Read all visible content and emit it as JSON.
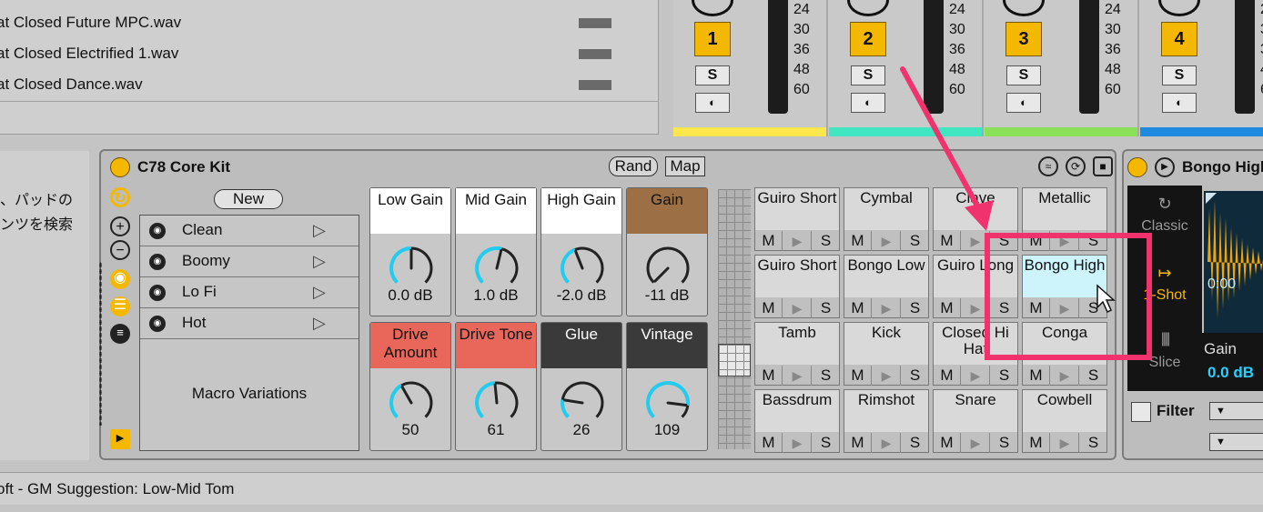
{
  "browser": {
    "files": [
      "at Closed Future MPC.wav",
      "at Closed Electrified 1.wav",
      "at Closed Dance.wav"
    ]
  },
  "mixer": {
    "scale": [
      "24",
      "30",
      "36",
      "48",
      "60"
    ],
    "solo_label": "S",
    "tracks": [
      {
        "number": "1",
        "color": "#fde74c"
      },
      {
        "number": "2",
        "color": "#3fe6c0"
      },
      {
        "number": "3",
        "color": "#8be05a"
      },
      {
        "number": "4",
        "color": "#1f8be0"
      }
    ]
  },
  "sidepanel": {
    "lines": [
      "、パッドの",
      "ンツを検索"
    ]
  },
  "rack": {
    "name": "C78 Core Kit",
    "rand_label": "Rand",
    "map_label": "Map",
    "macro_variations": {
      "new_label": "New",
      "items": [
        "Clean",
        "Boomy",
        "Lo Fi",
        "Hot"
      ],
      "caption": "Macro Variations"
    },
    "macros": [
      {
        "label": "Low Gain",
        "value": "0.0 dB",
        "head_color": "#ffffff",
        "text_color": "#111111",
        "level": 0.5
      },
      {
        "label": "Mid Gain",
        "value": "1.0 dB",
        "head_color": "#ffffff",
        "text_color": "#111111",
        "level": 0.55
      },
      {
        "label": "High Gain",
        "value": "-2.0 dB",
        "head_color": "#ffffff",
        "text_color": "#111111",
        "level": 0.42
      },
      {
        "label": "Gain",
        "value": "-11 dB",
        "head_color": "#9c7044",
        "text_color": "#111111",
        "level": 0.0
      },
      {
        "label": "Drive Amount",
        "value": "50",
        "head_color": "#e8675a",
        "text_color": "#111111",
        "level": 0.39
      },
      {
        "label": "Drive Tone",
        "value": "61",
        "head_color": "#e8675a",
        "text_color": "#111111",
        "level": 0.48
      },
      {
        "label": "Glue",
        "value": "26",
        "head_color": "#3a3a3a",
        "text_color": "#ffffff",
        "level": 0.2
      },
      {
        "label": "Vintage",
        "value": "109",
        "head_color": "#3a3a3a",
        "text_color": "#ffffff",
        "level": 0.86
      }
    ],
    "pads": [
      [
        "Guiro Short",
        "Cymbal",
        "Clave",
        "Metallic"
      ],
      [
        "Guiro Short",
        "Bongo Low",
        "Guiro Long",
        "Bongo High"
      ],
      [
        "Tamb",
        "Kick",
        "Closed Hi Hat",
        "Conga"
      ],
      [
        "Bassdrum",
        "Rimshot",
        "Snare",
        "Cowbell"
      ]
    ],
    "mute_label": "M",
    "solo_label": "S"
  },
  "simpler": {
    "title": "Bongo High",
    "modes": [
      "Classic",
      "1-Shot",
      "Slice"
    ],
    "time": "0:00",
    "gain_label": "Gain",
    "gain_value": "0.0 dB",
    "filter_label": "Filter"
  },
  "status": {
    "text": "oft - GM Suggestion: Low-Mid Tom"
  },
  "colors": {
    "accent": "#f5b800",
    "highlight": "#f0336e",
    "knob_arc": "#22ccee",
    "wave": "#f5a300"
  }
}
